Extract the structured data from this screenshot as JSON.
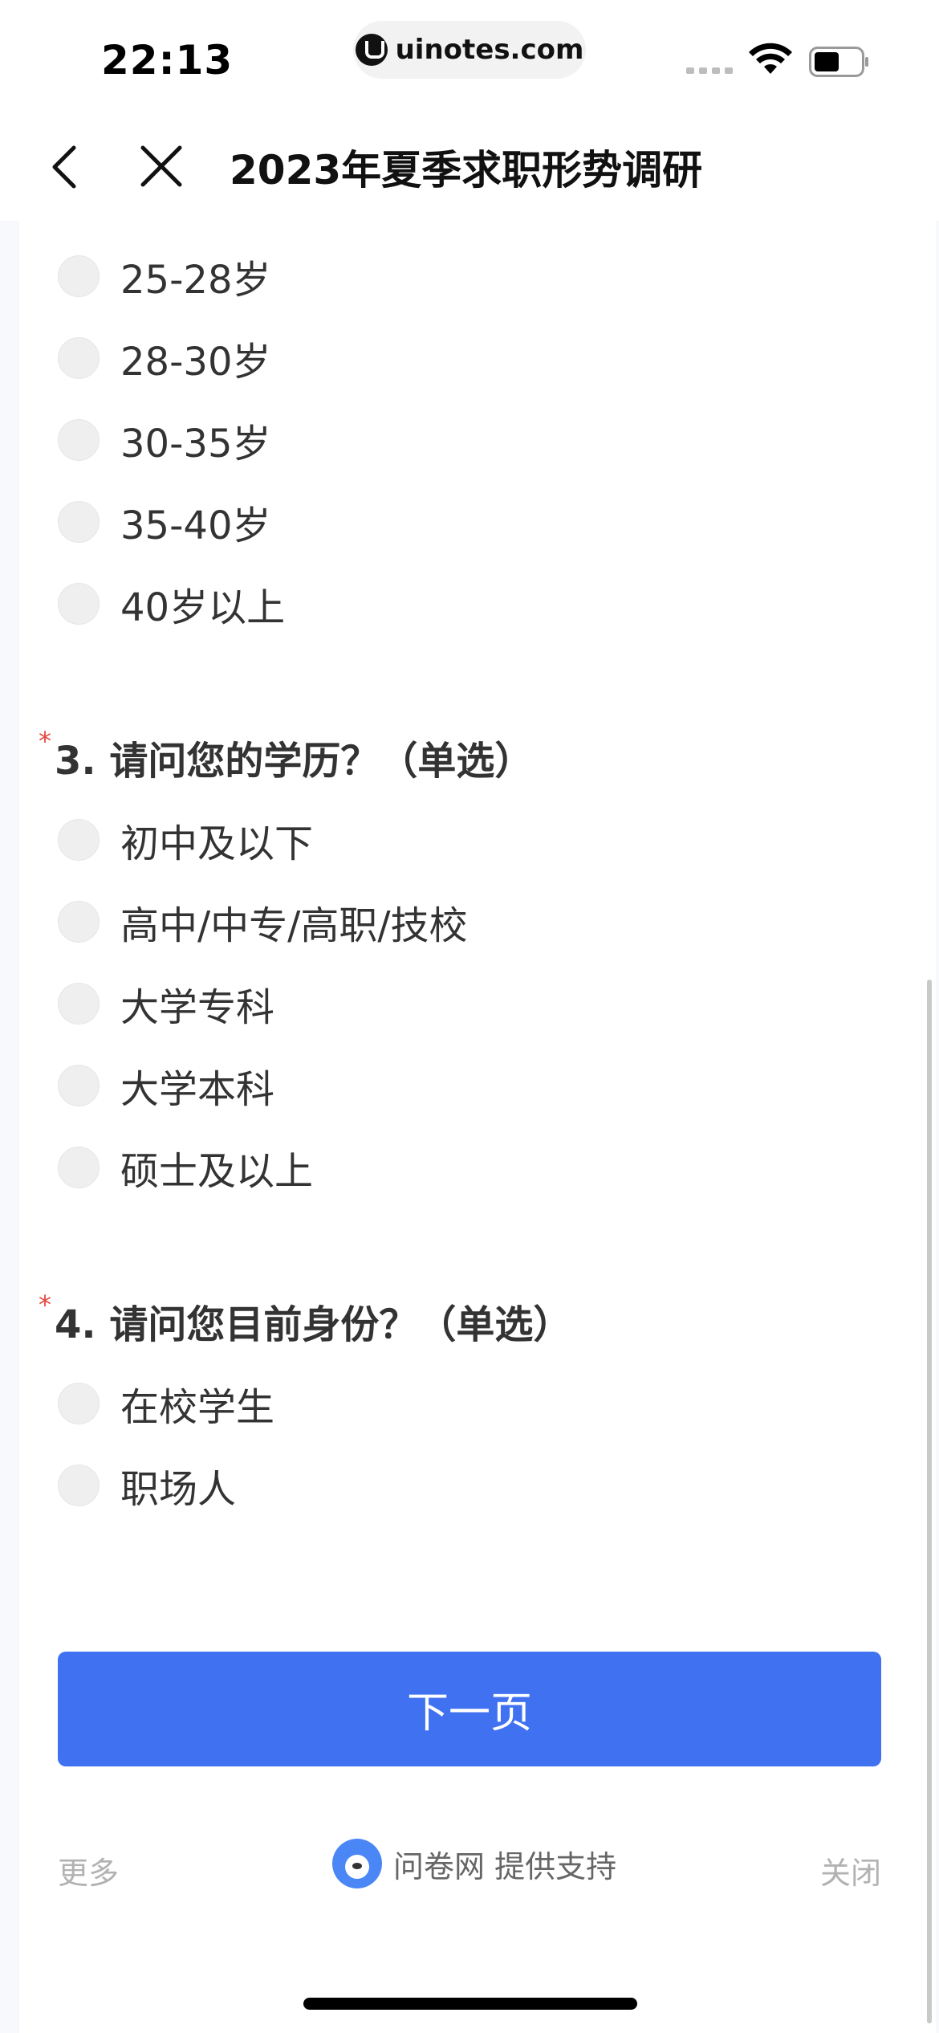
{
  "status_bar": {
    "time": "22:13",
    "url": "uinotes.com"
  },
  "nav": {
    "title": "2023年夏季求职形势调研"
  },
  "question_2": {
    "options": [
      "25-28岁",
      "28-30岁",
      "30-35岁",
      "35-40岁",
      "40岁以上"
    ]
  },
  "question_3": {
    "required_mark": "*",
    "title": "3. 请问您的学历？（单选）",
    "options": [
      "初中及以下",
      "高中/中专/高职/技校",
      "大学专科",
      "大学本科",
      "硕士及以上"
    ]
  },
  "question_4": {
    "required_mark": "*",
    "title": "4. 请问您目前身份？（单选）",
    "options": [
      "在校学生",
      "职场人"
    ]
  },
  "next_button": {
    "label": "下一页"
  },
  "footer": {
    "more": "更多",
    "brand": "问卷网 提供支持",
    "close": "关闭"
  },
  "colors": {
    "accent": "#4071f1",
    "required": "#e5483f"
  }
}
